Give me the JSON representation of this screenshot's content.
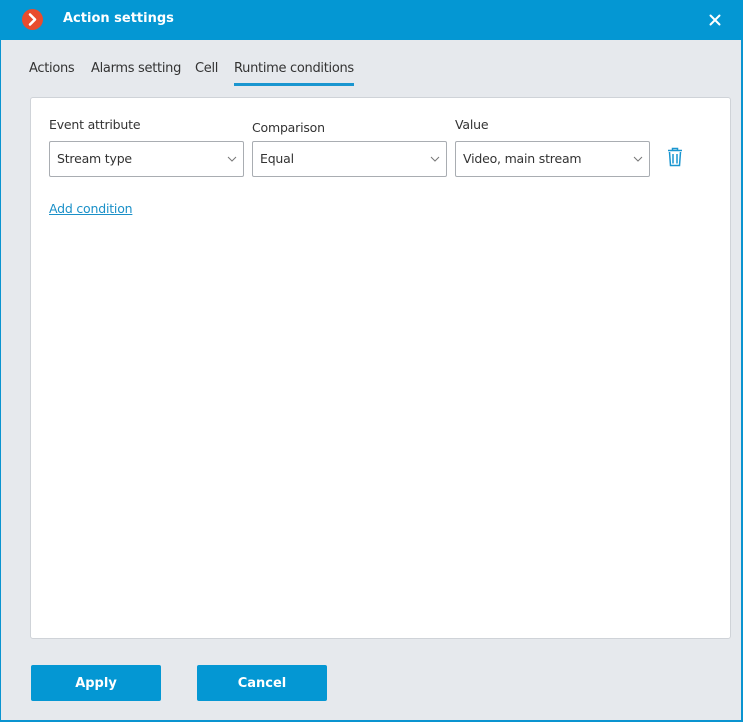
{
  "window": {
    "title": "Action settings",
    "logo_icon": "app-logo-chevron-icon",
    "close_icon": "close-icon"
  },
  "tabs": [
    {
      "label": "Actions",
      "active": false
    },
    {
      "label": "Alarms setting",
      "active": false
    },
    {
      "label": "Cell",
      "active": false
    },
    {
      "label": "Runtime conditions",
      "active": true
    }
  ],
  "conditions": {
    "columns": {
      "attribute": "Event attribute",
      "comparison": "Comparison",
      "value": "Value"
    },
    "rows": [
      {
        "attribute": "Stream type",
        "comparison": "Equal",
        "value": "Video, main stream",
        "delete_icon": "trash-icon"
      }
    ],
    "add_label": "Add condition"
  },
  "footer": {
    "apply_label": "Apply",
    "cancel_label": "Cancel"
  },
  "colors": {
    "accent": "#0497d3",
    "logo": "#e84c2e",
    "link": "#1a90c8"
  }
}
